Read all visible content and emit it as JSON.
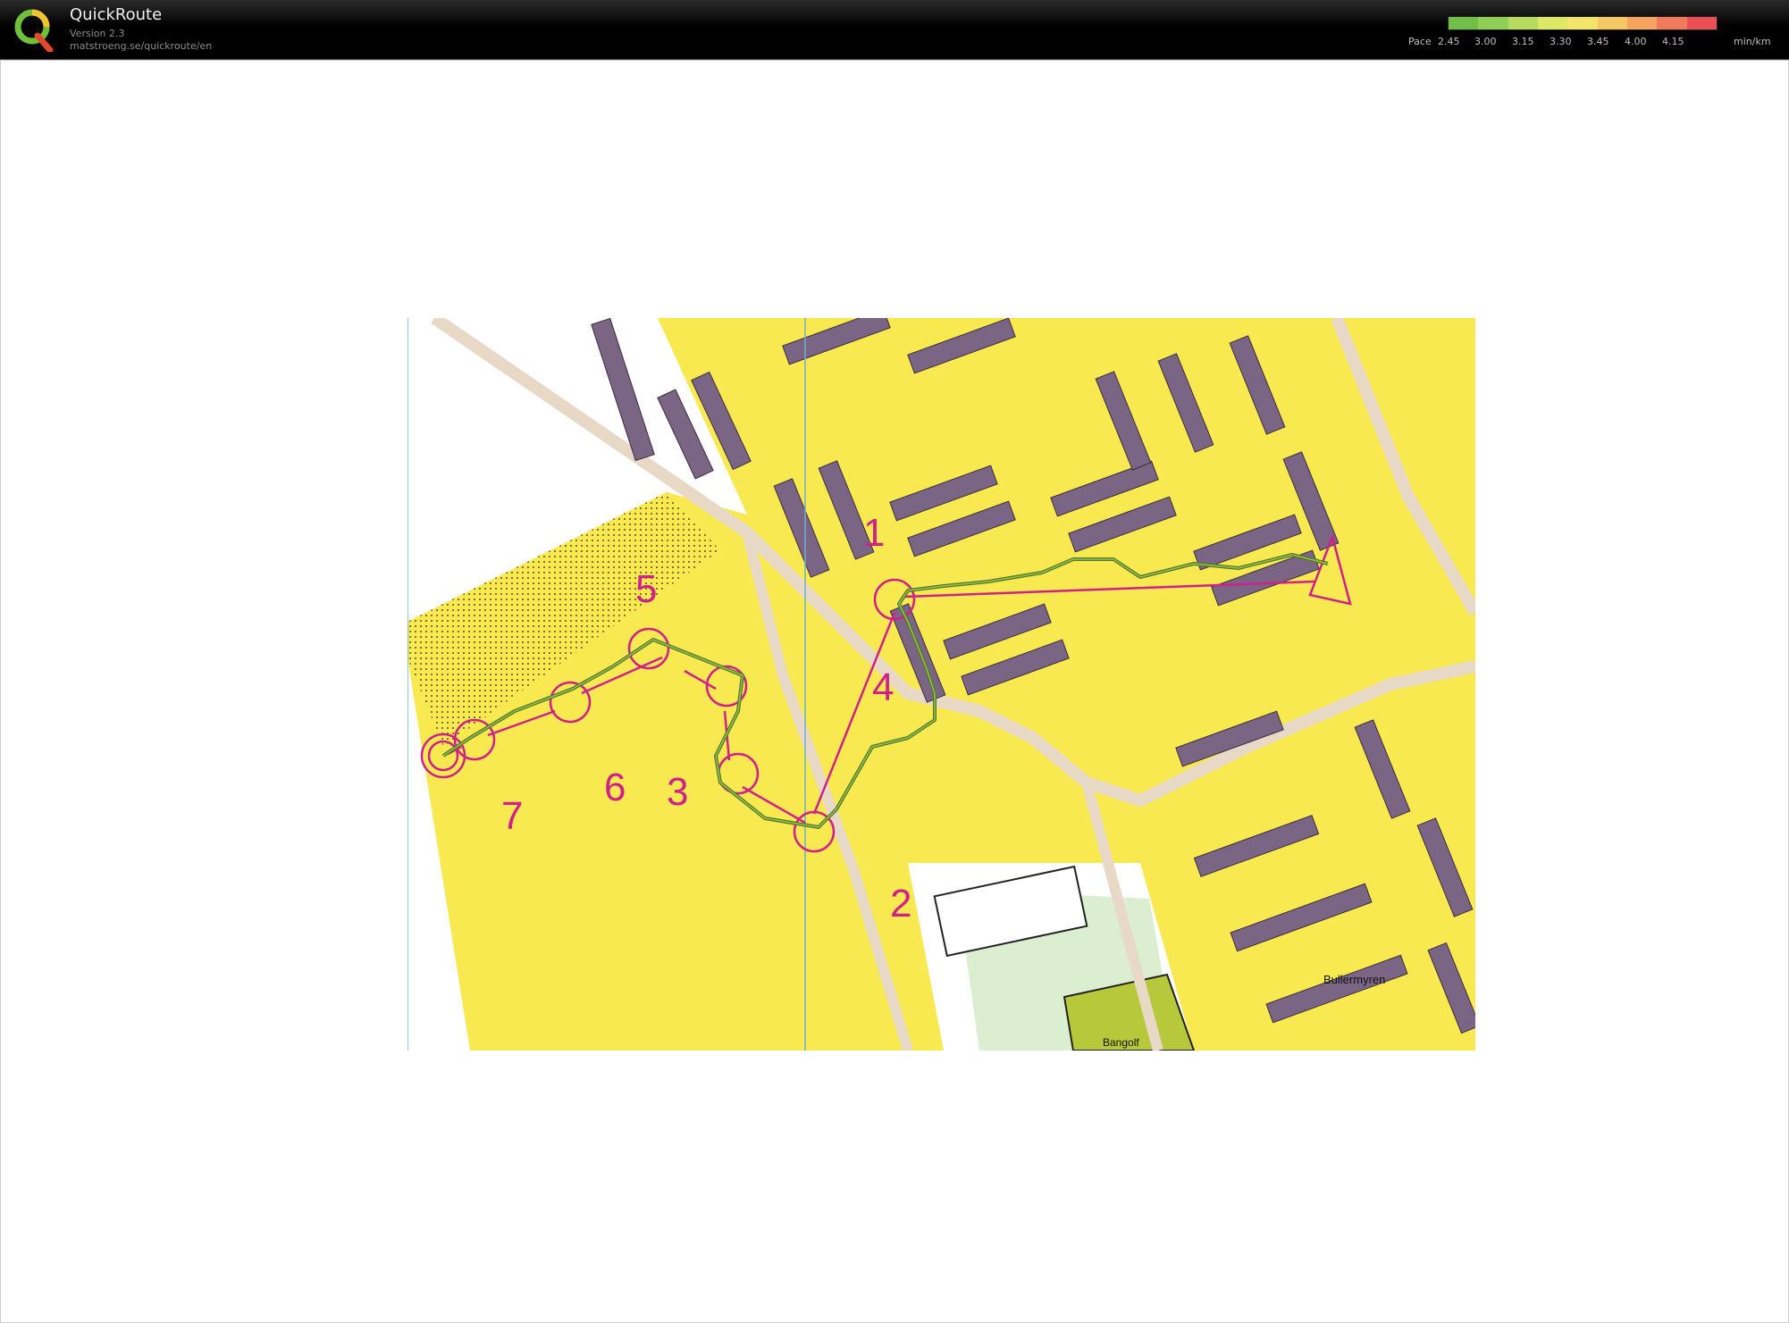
{
  "app": {
    "title": "QuickRoute",
    "version": "Version 2.3",
    "url": "matstroeng.se/quickroute/en"
  },
  "legend": {
    "label": "Pace",
    "ticks": [
      "2.45",
      "3.00",
      "3.15",
      "3.30",
      "3.45",
      "4.00",
      "4.15"
    ],
    "unit": "min/km",
    "colors": [
      "#6fbf4a",
      "#8fcf55",
      "#b5dc5e",
      "#dde866",
      "#f3e56a",
      "#f5c865",
      "#f5a560",
      "#f07a5a",
      "#ea4f55"
    ]
  },
  "map": {
    "controls": [
      "1",
      "2",
      "3",
      "4",
      "5",
      "6",
      "7"
    ],
    "place_labels": [
      "Bullermyren",
      "Bangolf"
    ],
    "colors": {
      "open_land": "#f7e94f",
      "building": "#7a6585",
      "course": "#d0208a",
      "route": "#4f7a2a"
    }
  }
}
